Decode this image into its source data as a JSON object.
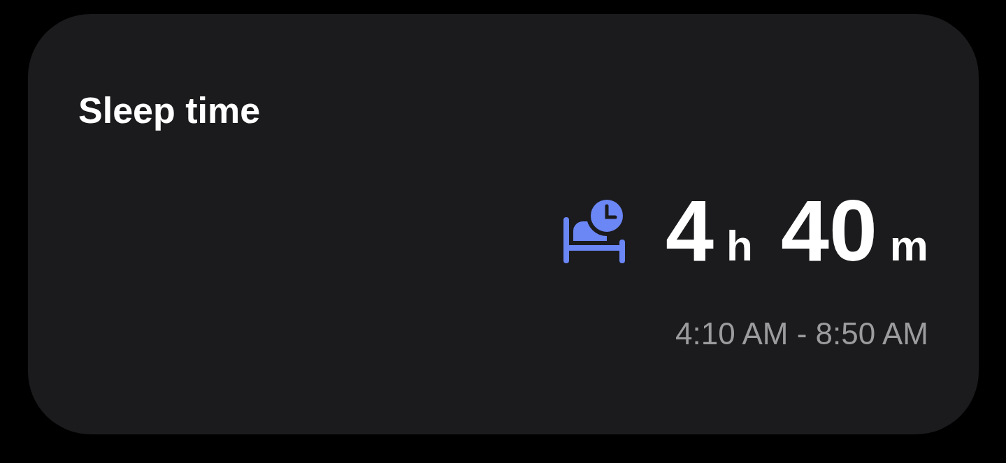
{
  "card": {
    "title": "Sleep time",
    "duration": [
      {
        "value": "4",
        "unit": "h"
      },
      {
        "value": "40",
        "unit": "m"
      }
    ],
    "range": "4:10 AM - 8:50 AM"
  }
}
